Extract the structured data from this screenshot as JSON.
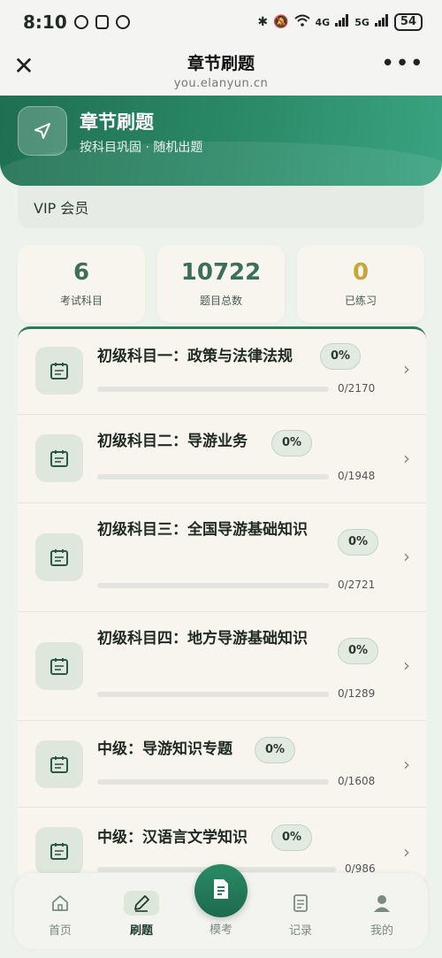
{
  "status": {
    "time": "8:10",
    "battery": "54",
    "net1": "4G",
    "net2": "5G"
  },
  "nav": {
    "title": "章节刷题",
    "url": "you.elanyun.cn",
    "more": "•••",
    "close": "✕"
  },
  "hero": {
    "title": "章节刷题",
    "subtitle": "按科目巩固 · 随机出题"
  },
  "vip": {
    "label": "VIP 会员"
  },
  "stats": [
    {
      "value": "6",
      "label": "考试科目"
    },
    {
      "value": "10722",
      "label": "题目总数"
    },
    {
      "value": "0",
      "label": "已练习"
    }
  ],
  "subjects": [
    {
      "title": "初级科目一：政策与法律法规",
      "percent": "0%",
      "count": "0/2170",
      "progress": 0
    },
    {
      "title": "初级科目二：导游业务",
      "percent": "0%",
      "count": "0/1948",
      "progress": 0
    },
    {
      "title": "初级科目三：全国导游基础知识",
      "percent": "0%",
      "count": "0/2721",
      "progress": 0
    },
    {
      "title": "初级科目四：地方导游基础知识",
      "percent": "0%",
      "count": "0/1289",
      "progress": 0
    },
    {
      "title": "中级：导游知识专题",
      "percent": "0%",
      "count": "0/1608",
      "progress": 0
    },
    {
      "title": "中级：汉语言文学知识",
      "percent": "0%",
      "count": "0/986",
      "progress": 0
    }
  ],
  "tabs": [
    {
      "label": "首页",
      "icon": "home-icon"
    },
    {
      "label": "刷题",
      "icon": "pencil-icon"
    },
    {
      "label": "模考",
      "icon": "exam-doc-icon"
    },
    {
      "label": "记录",
      "icon": "record-icon"
    },
    {
      "label": "我的",
      "icon": "user-icon"
    }
  ],
  "colors": {
    "primary": "#2b8a68",
    "gold": "#c8a53a",
    "statGreen": "#3d6e5a"
  }
}
